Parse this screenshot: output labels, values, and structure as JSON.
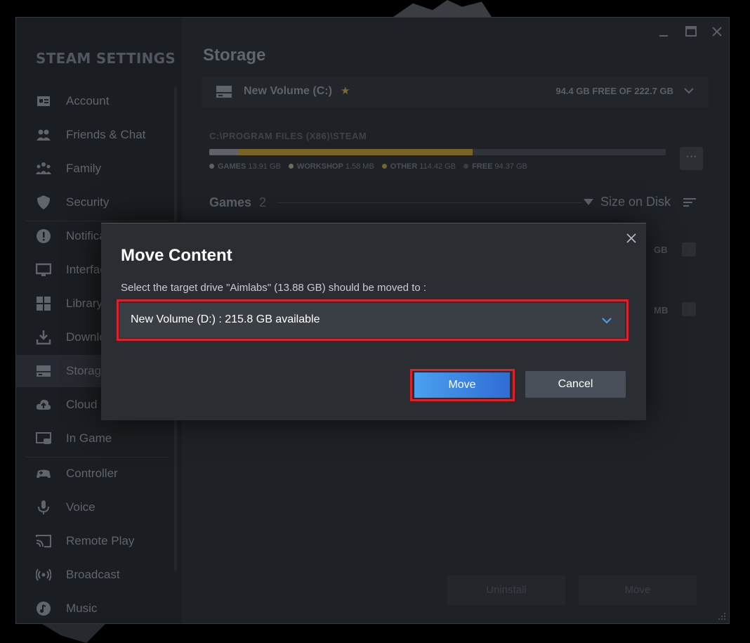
{
  "window": {
    "sidebar_title": "STEAM SETTINGS",
    "sidebar_items": [
      {
        "label": "Account",
        "icon": "account-card-icon"
      },
      {
        "label": "Friends & Chat",
        "icon": "friends-icon"
      },
      {
        "label": "Family",
        "icon": "family-icon"
      },
      {
        "label": "Security",
        "icon": "shield-icon"
      },
      {
        "label": "Notifications",
        "icon": "notification-icon"
      },
      {
        "label": "Interface",
        "icon": "monitor-icon"
      },
      {
        "label": "Library",
        "icon": "library-grid-icon"
      },
      {
        "label": "Downloads",
        "icon": "download-icon"
      },
      {
        "label": "Storage",
        "icon": "storage-drive-icon",
        "active": true
      },
      {
        "label": "Cloud",
        "icon": "cloud-icon"
      },
      {
        "label": "In Game",
        "icon": "in-game-icon"
      },
      {
        "label": "Controller",
        "icon": "gamepad-icon"
      },
      {
        "label": "Voice",
        "icon": "microphone-icon"
      },
      {
        "label": "Remote Play",
        "icon": "cast-icon"
      },
      {
        "label": "Broadcast",
        "icon": "broadcast-icon"
      },
      {
        "label": "Music",
        "icon": "music-icon"
      }
    ]
  },
  "storage": {
    "title": "Storage",
    "drive_name": "New Volume (C:)",
    "drive_star": "★",
    "drive_free": "94.4 GB FREE OF 222.7 GB",
    "path": "C:\\PROGRAM FILES (X86)\\STEAM",
    "usage": [
      {
        "label": "GAMES",
        "value": "13.91 GB",
        "color": "#5f6369",
        "gb": 13.91
      },
      {
        "label": "WORKSHOP",
        "value": "1.58 MB",
        "color": "#6b6f56",
        "gb": 0.00158
      },
      {
        "label": "OTHER",
        "value": "114.42 GB",
        "color": "#7a6424",
        "gb": 114.42
      },
      {
        "label": "FREE",
        "value": "94.37 GB",
        "color": "#30343a",
        "gb": 94.37
      }
    ],
    "more_label": "···",
    "games_heading": "Games",
    "games_count": "2",
    "sort_label": "Size on Disk",
    "row_sizes": [
      "GB",
      "MB"
    ],
    "uninstall_label": "Uninstall",
    "move_label": "Move"
  },
  "modal": {
    "title": "Move Content",
    "subtitle": "Select the target drive \"Aimlabs\" (13.88 GB) should be moved to :",
    "selected_drive": "New Volume (D:) : 215.8 GB available",
    "move_button": "Move",
    "cancel_button": "Cancel"
  },
  "colors": {
    "accent_blue": "#2f6cd4",
    "highlight_red": "#e0202a"
  }
}
